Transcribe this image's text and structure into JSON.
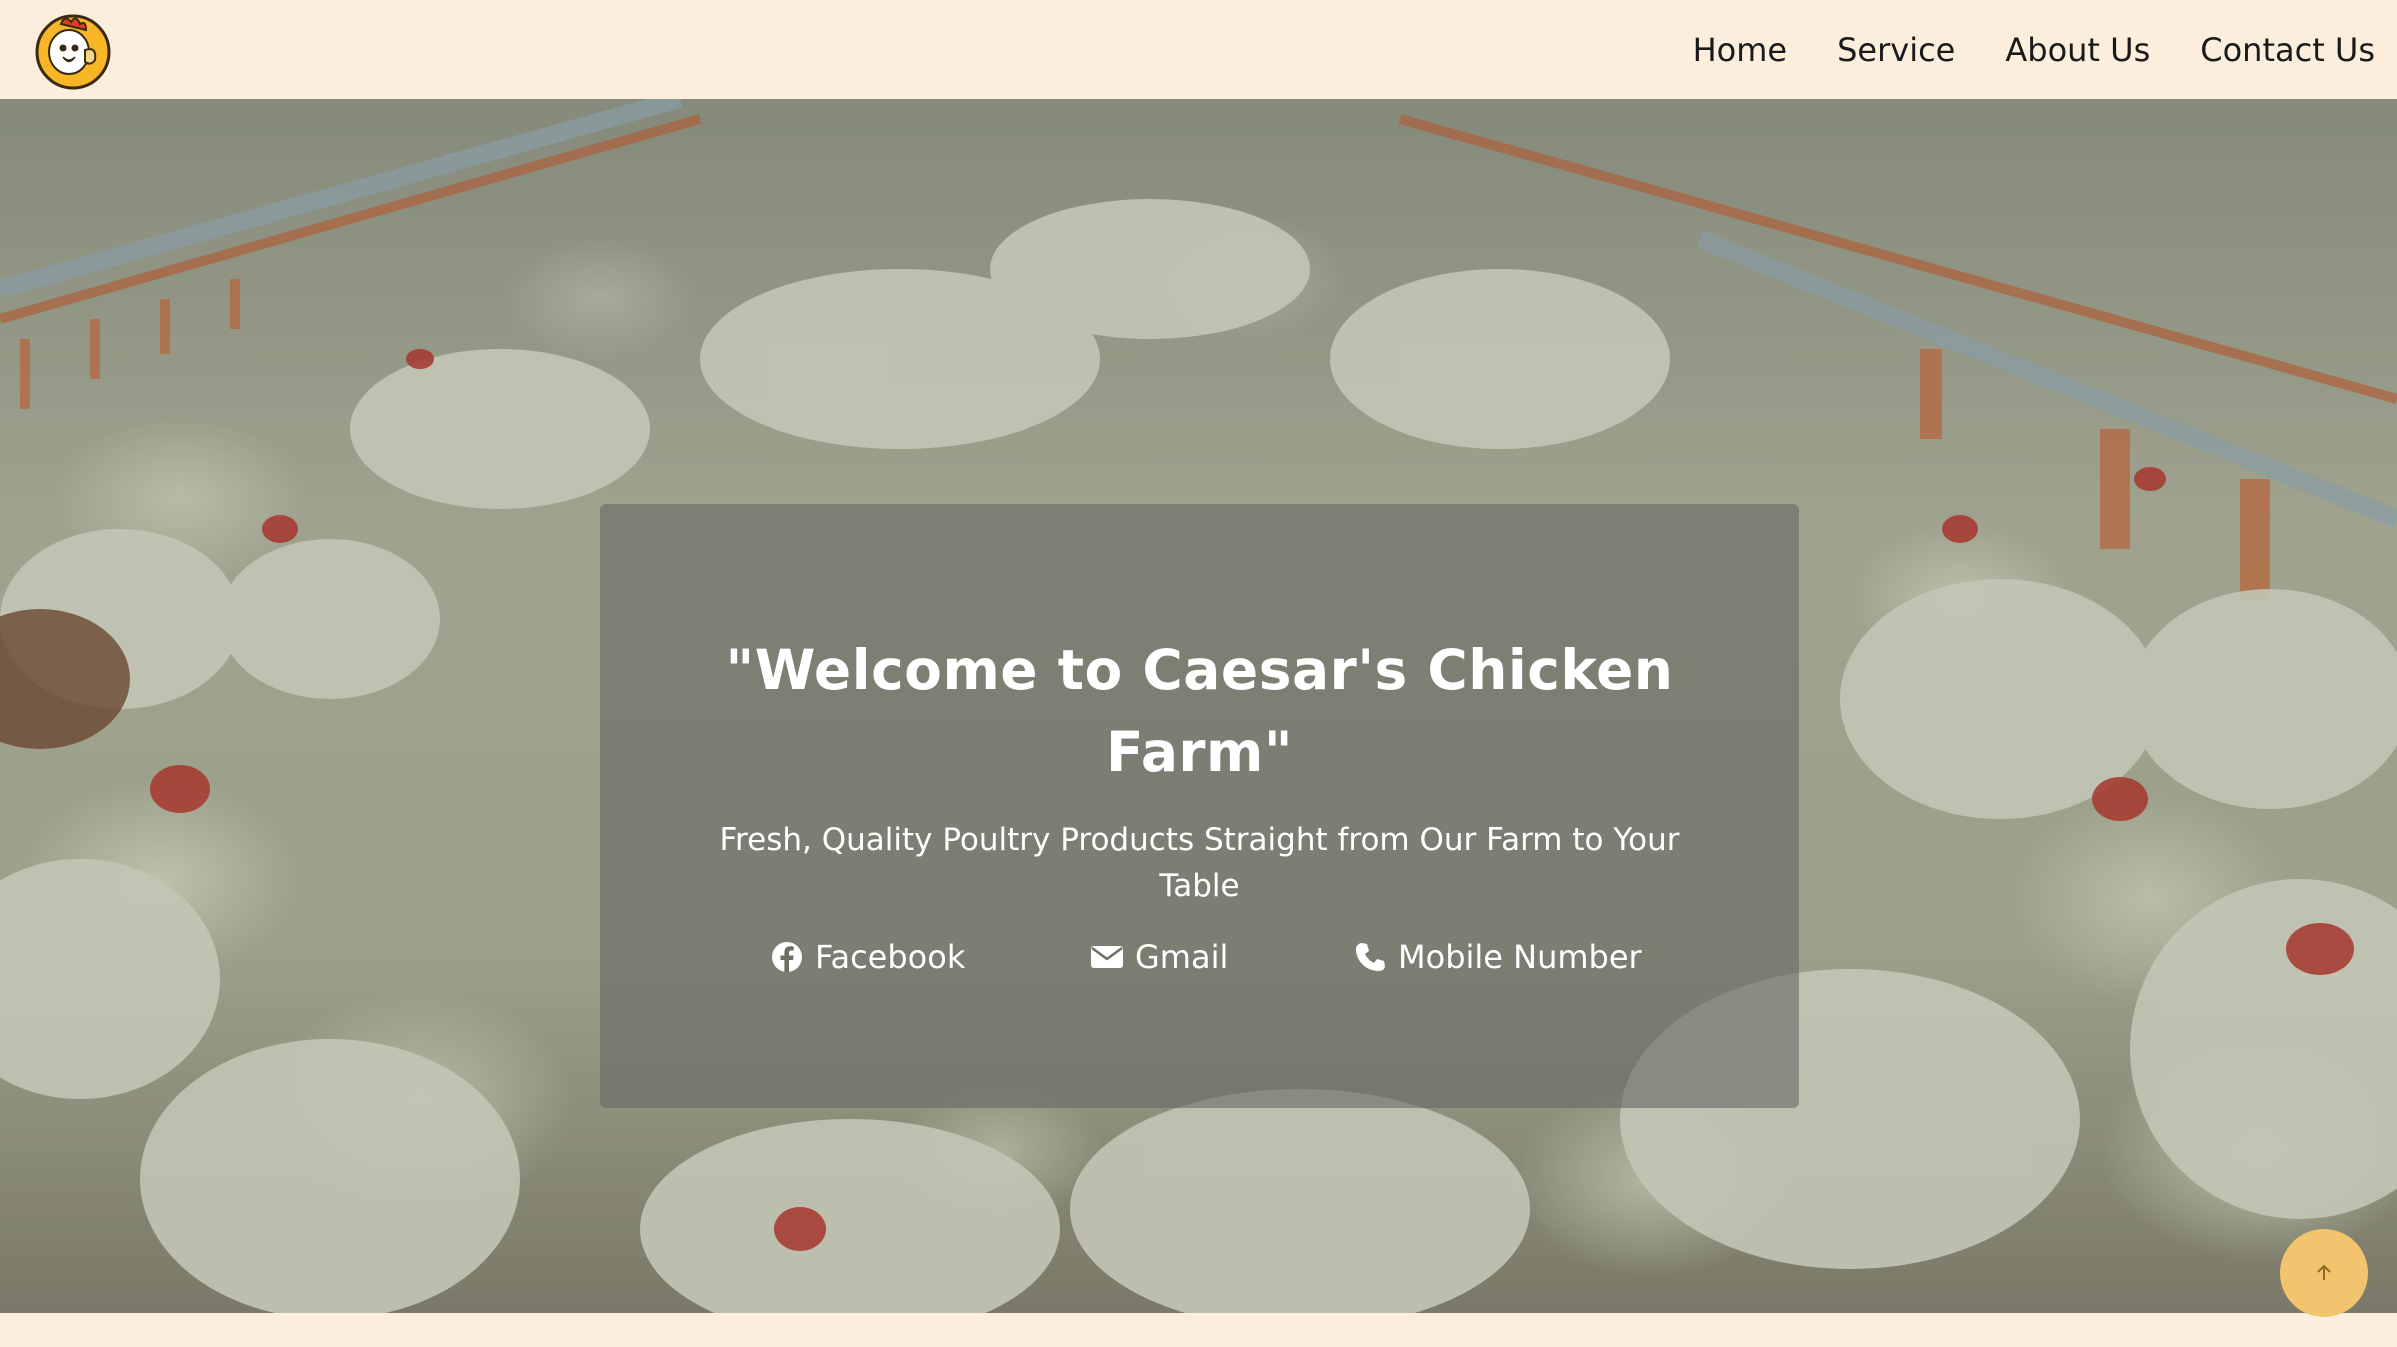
{
  "header": {
    "logo_icon": "chicken-mascot-logo",
    "nav": [
      {
        "label": "Home"
      },
      {
        "label": "Service"
      },
      {
        "label": "About Us"
      },
      {
        "label": "Contact Us"
      }
    ]
  },
  "hero": {
    "background": "chicken-farm-photo",
    "title": "\"Welcome to Caesar's Chicken Farm\"",
    "subtitle": "Fresh, Quality Poultry Products Straight from Our Farm to Your Table",
    "links": [
      {
        "icon": "facebook-icon",
        "label": "Facebook"
      },
      {
        "icon": "mail-icon",
        "label": "Gmail"
      },
      {
        "icon": "phone-icon",
        "label": "Mobile Number"
      }
    ]
  },
  "scroll_top": {
    "icon": "arrow-up-icon",
    "color": "#f2c46d"
  },
  "colors": {
    "header_bg": "#fbeedd",
    "card_overlay": "#69695f",
    "text_light": "#ffffff"
  }
}
